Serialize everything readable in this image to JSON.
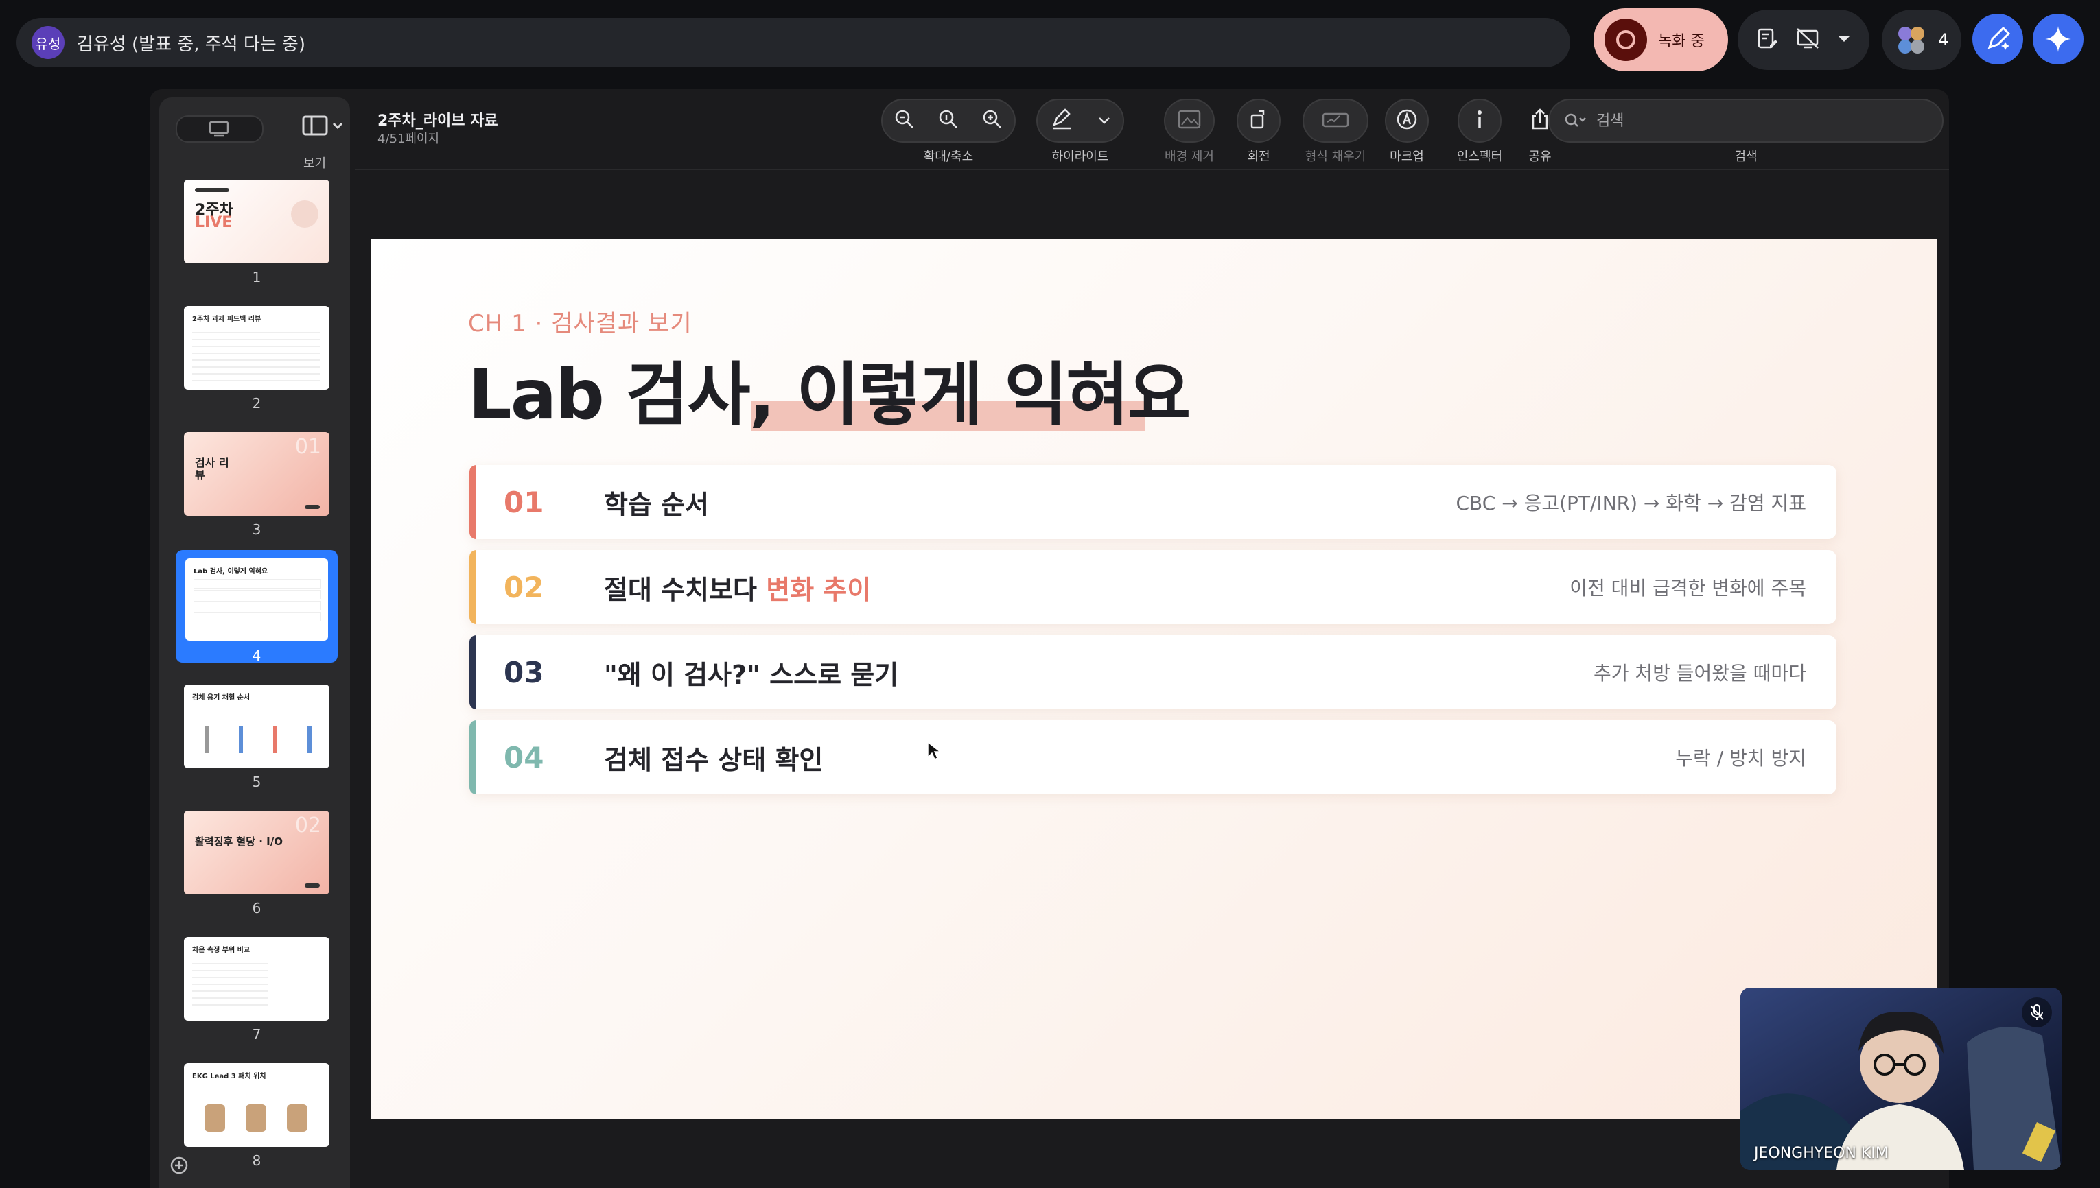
{
  "meet": {
    "presenter_avatar": "유성",
    "presenter_text": "김유성 (발표 중, 주석 다는 중)",
    "recording_label": "녹화 중",
    "participant_count": "4",
    "accent": "#3c6bef",
    "recording_color": "#f3b8b2"
  },
  "preview": {
    "doc_title": "2주차_라이브 자료",
    "doc_page": "4/51페이지",
    "view_label": "보기",
    "toolbar": {
      "zoom_label": "확대/축소",
      "highlight_label": "하이라이트",
      "remove_bg_label": "배경 제거",
      "rotate_label": "회전",
      "fill_label": "형식 채우기",
      "markup_label": "마크업",
      "inspector_label": "인스펙터",
      "share_label": "공유",
      "search_label": "검색",
      "search_placeholder": "검색"
    },
    "thumbnails": [
      {
        "num": "1",
        "title": "2주차",
        "subtitle": "LIVE"
      },
      {
        "num": "2",
        "title": "2주차 과제 피드백 리뷰"
      },
      {
        "num": "3",
        "title": "검사 리뷰",
        "badge": "01"
      },
      {
        "num": "4",
        "title": "Lab 검사, 이렇게 익혀요",
        "selected": true
      },
      {
        "num": "5",
        "title": "검체 용기 채혈 순서"
      },
      {
        "num": "6",
        "title": "활력징후 혈당 · I/O",
        "badge": "02"
      },
      {
        "num": "7",
        "title": "체온 측정 부위 비교"
      },
      {
        "num": "8",
        "title": "EKG Lead 3 패치 위치"
      }
    ]
  },
  "slide": {
    "kicker": "CH 1 · 검사결과 보기",
    "title_plain": "Lab 검사, ",
    "title_emph": "이렇게 익혀요",
    "rows": [
      {
        "num": "01",
        "label": "학습 순서",
        "highlight": "",
        "note": "CBC → 응고(PT/INR) → 화학 → 감염 지표",
        "color": "#e8796a"
      },
      {
        "num": "02",
        "label": "절대 수치보다 ",
        "highlight": "변화 추이",
        "note": "이전 대비 급격한 변화에 주목",
        "color": "#f2b45c"
      },
      {
        "num": "03",
        "label": "\"왜 이 검사?\" 스스로 묻기",
        "highlight": "",
        "note": "추가 처방 들어왔을 때마다",
        "color": "#2c3550"
      },
      {
        "num": "04",
        "label": "검체 접수 상태 확인",
        "highlight": "",
        "note": "누락 / 방치 방지",
        "color": "#7fb8ae"
      }
    ]
  },
  "camera": {
    "name": "JEONGHYEON KIM"
  }
}
